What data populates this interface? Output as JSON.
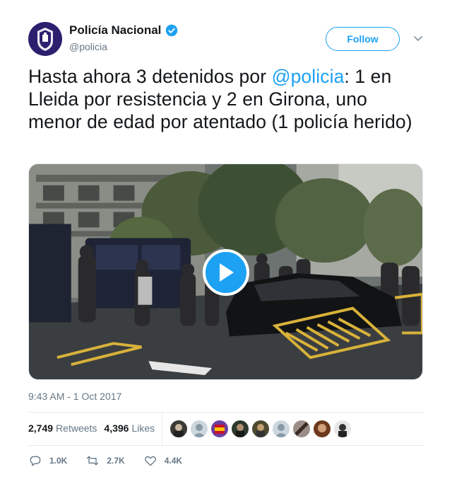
{
  "account": {
    "name": "Policía Nacional",
    "handle": "@policia",
    "follow_label": "Follow"
  },
  "tweet": {
    "text_before": "Hasta ahora 3 detenidos por ",
    "mention": "@policia",
    "text_after": ": 1 en Lleida por resistencia y 2 en Girona, uno menor de edad por atentado (1 policía herido)",
    "timestamp": "9:43 AM - 1 Oct 2017"
  },
  "stats": {
    "retweets_count": "2,749",
    "retweets_label": "Retweets",
    "likes_count": "4,396",
    "likes_label": "Likes"
  },
  "actions": {
    "replies": "1.0K",
    "retweets": "2.7K",
    "likes": "4.4K"
  },
  "colors": {
    "accent": "#1da1f2",
    "text": "#14171a",
    "muted": "#657786",
    "avatar_bg": "#2c1f6e"
  }
}
